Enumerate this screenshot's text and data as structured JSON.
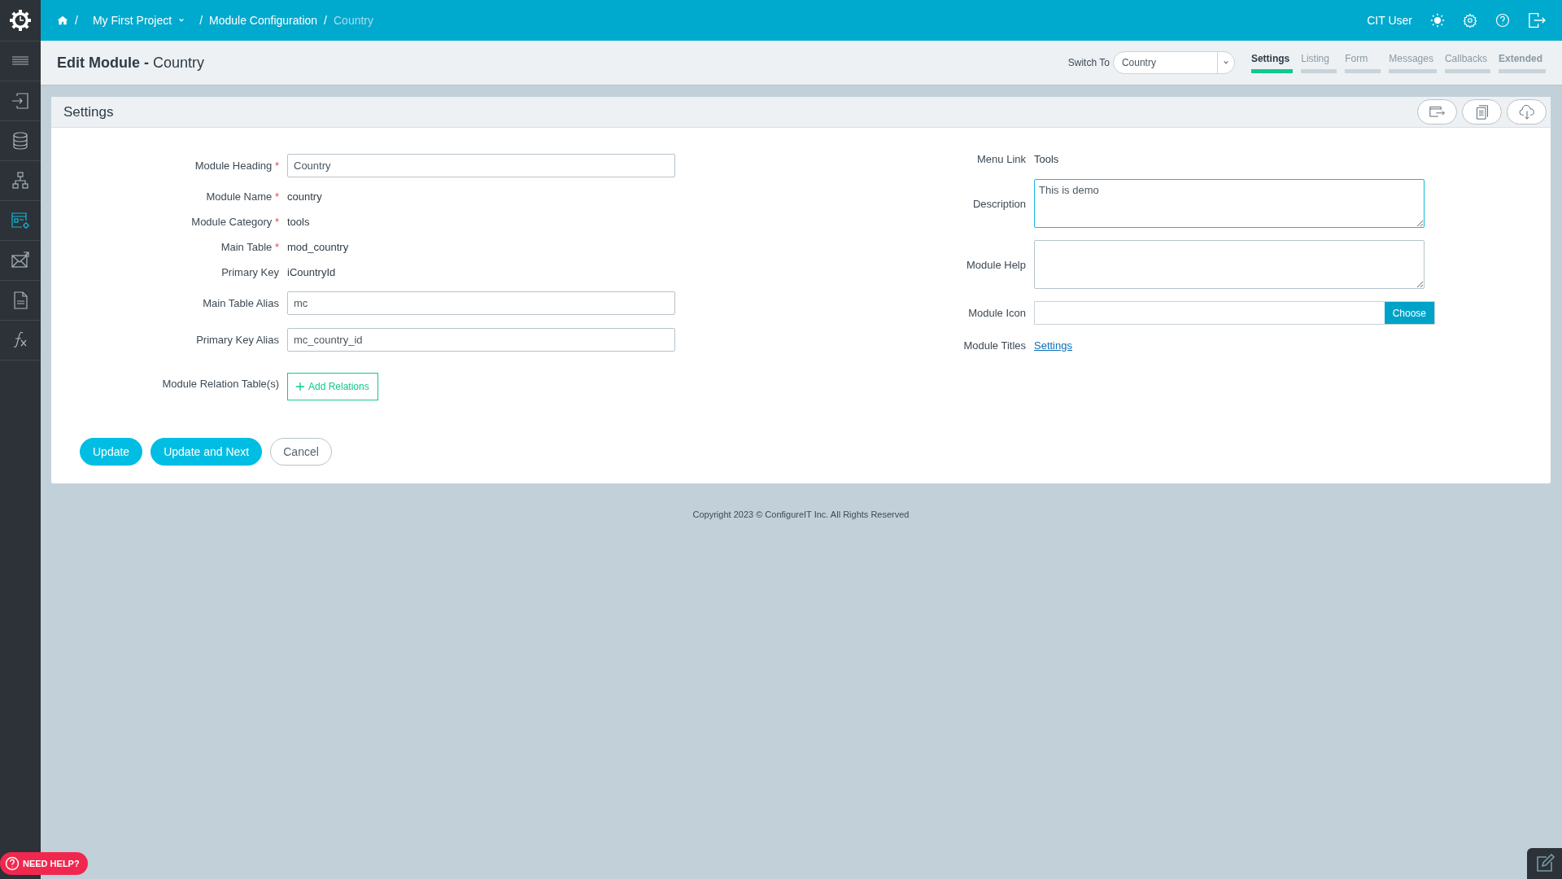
{
  "sidebar": {
    "items": [
      {
        "kind": "menu",
        "selected": false
      },
      {
        "kind": "enter",
        "selected": false
      },
      {
        "kind": "database",
        "selected": false
      },
      {
        "kind": "hierarchy",
        "selected": false
      },
      {
        "kind": "window-gear",
        "selected": true
      },
      {
        "kind": "mail",
        "selected": false
      },
      {
        "kind": "file",
        "selected": false
      },
      {
        "kind": "function",
        "selected": false
      }
    ]
  },
  "breadcrumb": [
    {
      "label": "My First Project",
      "dropdown": true,
      "current": false
    },
    {
      "label": "Module Configuration",
      "dropdown": false,
      "current": false
    },
    {
      "label": "Country",
      "dropdown": false,
      "current": true
    }
  ],
  "breadcrumb_separator": "/",
  "required_mark": "*",
  "user": {
    "name": "CIT User"
  },
  "page_title": {
    "bold": "Edit Module -",
    "rest": "Country"
  },
  "switch_to": {
    "label": "Switch To",
    "value": "Country"
  },
  "tabs": [
    {
      "label": "Settings",
      "selected": true,
      "bold": true
    },
    {
      "label": "Listing",
      "selected": false,
      "bold": false
    },
    {
      "label": "Form",
      "selected": false,
      "bold": false
    },
    {
      "label": "Messages",
      "selected": false,
      "bold": false
    },
    {
      "label": "Callbacks",
      "selected": false,
      "bold": false
    },
    {
      "label": "Extended",
      "selected": false,
      "bold": true
    }
  ],
  "card": {
    "title": "Settings"
  },
  "left_fields": [
    {
      "label": "Module Heading",
      "required": true,
      "kind": "input",
      "value": "Country"
    },
    {
      "label": "Module Name",
      "required": true,
      "kind": "text",
      "value": "country"
    },
    {
      "label": "Module Category",
      "required": true,
      "kind": "text",
      "value": "tools"
    },
    {
      "label": "Main Table",
      "required": true,
      "kind": "text",
      "value": "mod_country"
    },
    {
      "label": "Primary Key",
      "required": false,
      "kind": "text",
      "value": "iCountryId"
    },
    {
      "label": "Main Table Alias",
      "required": false,
      "kind": "input",
      "value": "mc"
    },
    {
      "label": "Primary Key Alias",
      "required": false,
      "kind": "input",
      "value": "mc_country_id"
    },
    {
      "label": "Module Relation Table(s)",
      "required": false,
      "kind": "add",
      "value": "Add Relations"
    }
  ],
  "right_fields": [
    {
      "label": "Menu Link",
      "kind": "text",
      "value": "Tools"
    },
    {
      "label": "Description",
      "kind": "textarea",
      "value": "This is demo",
      "focused": true
    },
    {
      "label": "Module Help",
      "kind": "textarea",
      "focused": false
    },
    {
      "label": "Module Icon",
      "kind": "choose",
      "value": "Choose"
    },
    {
      "label": "Module Titles",
      "kind": "link",
      "value": "Settings"
    }
  ],
  "buttons": [
    {
      "label": "Update",
      "kind": "primary"
    },
    {
      "label": "Update and Next",
      "kind": "primary"
    },
    {
      "label": "Cancel",
      "kind": "outline"
    }
  ],
  "copyright": "Copyright 2023 © ConfigureIT Inc. All Rights Reserved",
  "help_button": {
    "label": "NEED HELP?"
  }
}
